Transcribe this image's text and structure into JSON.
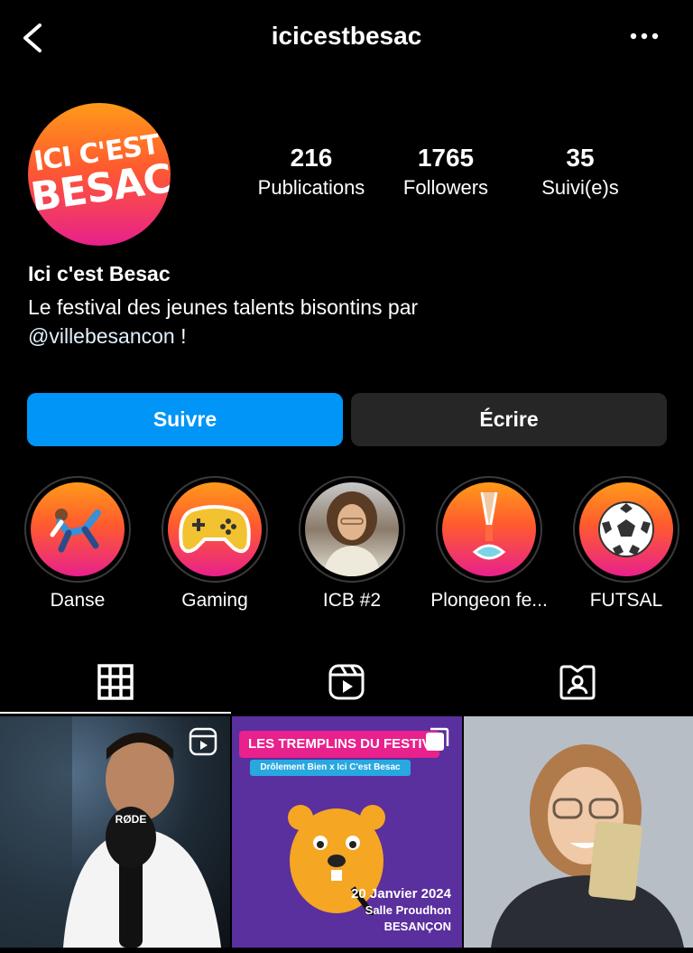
{
  "header": {
    "username": "icicestbesac"
  },
  "profile": {
    "avatar_text_line1": "ICI C'EST",
    "avatar_text_line2": "BESAC",
    "stats": [
      {
        "value": "216",
        "label": "Publications"
      },
      {
        "value": "1765",
        "label": "Followers"
      },
      {
        "value": "35",
        "label": "Suivi(e)s"
      }
    ],
    "name": "Ici c'est Besac",
    "bio_text": "Le festival des jeunes talents bisontins par",
    "bio_mention": "@villebesancon",
    "bio_suffix": " !"
  },
  "actions": {
    "follow_label": "Suivre",
    "message_label": "Écrire"
  },
  "highlights": [
    {
      "label": "Danse",
      "icon": "dancer-icon"
    },
    {
      "label": "Gaming",
      "icon": "gamepad-icon"
    },
    {
      "label": "ICB #2",
      "icon": "person-photo"
    },
    {
      "label": "Plongeon fe...",
      "icon": "diver-icon"
    },
    {
      "label": "FUTSAL",
      "icon": "soccer-ball-icon"
    }
  ],
  "tabs": [
    "grid-icon",
    "reels-icon",
    "tagged-icon"
  ],
  "posts": [
    {
      "type": "reel",
      "mic_text": "RØDE"
    },
    {
      "banner": "LES TREMPLINS DU FESTIVAL",
      "sub": "Drôlement Bien x Ici C'est Besac",
      "date": "20 Janvier 2024",
      "venue": "Salle Proudhon",
      "city": "BESANÇON"
    },
    {
      "type": "photo"
    }
  ],
  "colors": {
    "accent_blue": "#0095f6",
    "button_gray": "#262626",
    "gradient_top": "#ff9a1a",
    "gradient_bottom": "#e8218c"
  }
}
